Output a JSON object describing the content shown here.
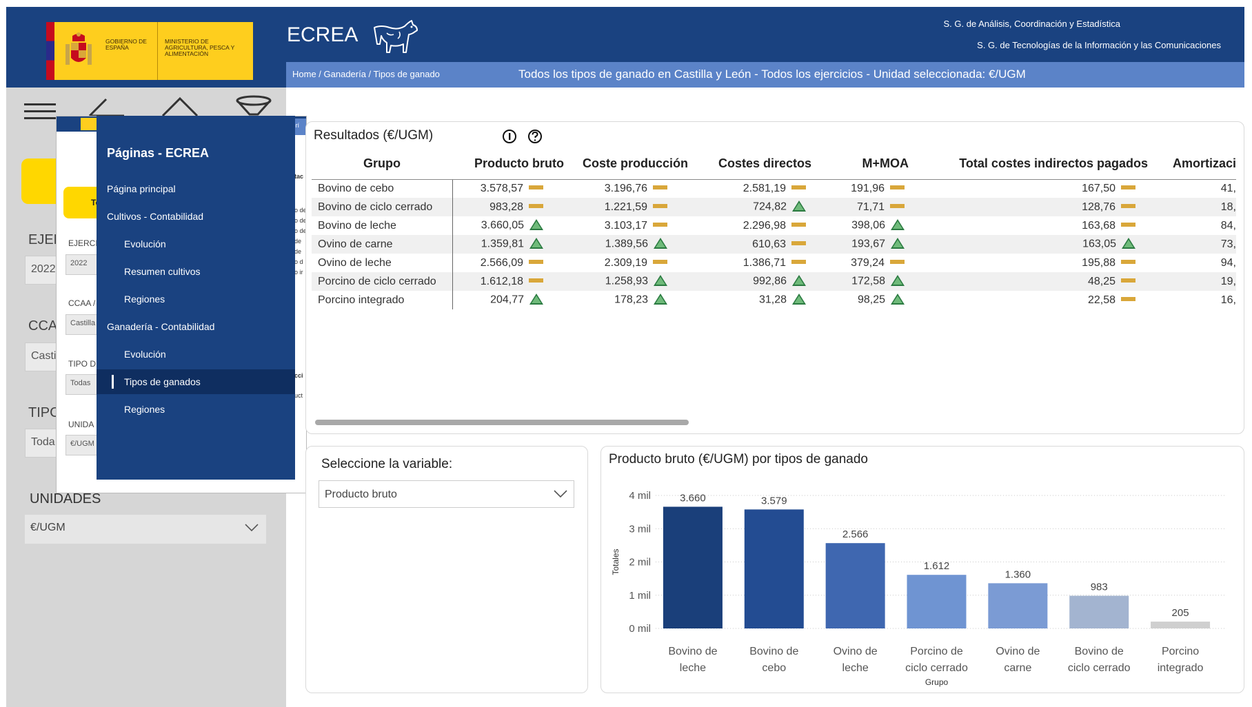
{
  "header": {
    "gov_text": "GOBIERNO DE ESPAÑA",
    "ministry_text": "MINISTERIO DE AGRICULTURA, PESCA Y ALIMENTACIÓN",
    "app_title": "ECREA",
    "sg_line1": "S. G. de Análisis, Coordinación y Estadística",
    "sg_line2": "S. G. de Tecnologías de la Información y las Comunicaciones",
    "colors": {
      "primary": "#1a4280",
      "subbar": "#5b83c8",
      "gov_yellow": "#fece1e"
    }
  },
  "subbar": {
    "breadcrumb": "Home / Ganadería / Tipos de ganado",
    "context": "Todos los tipos de ganado en Castilla y León - Todos los ejercicios - Unidad seleccionada: €/UGM"
  },
  "toolbar_icons": [
    "hamburger-icon",
    "back-icon",
    "home-icon",
    "clear-filter-icon"
  ],
  "left_panel": {
    "ejercicio_label": "EJER",
    "ejercicio_value": "2022",
    "ccaa_label": "CCA",
    "ccaa_value": "Casti",
    "tipo_label": "TIPC",
    "tipo_value": "Toda",
    "unidades_label": "UNIDADES",
    "unidades_value": "€/UGM"
  },
  "mini_preview": {
    "crumb": "Home / Ganaderí",
    "button": "To",
    "ejercicio_label": "EJERCI",
    "ejercicio_value": "2022",
    "ccaa_label": "CCAA /",
    "ccaa_value": "Castilla",
    "tipo_label": "TIPO D",
    "tipo_value": "Todas",
    "unidad_label": "UNIDA",
    "unidad_value": "€/UGM",
    "strip_top": "tac",
    "strip_lines": [
      "o de",
      "o de",
      "o de",
      "de",
      "de",
      "o d",
      "o ir"
    ],
    "strip_bottom1": "cci",
    "strip_bottom2": "uct"
  },
  "nav_menu": {
    "title": "Páginas - ECREA",
    "items": [
      {
        "label": "Página principal",
        "level": 0
      },
      {
        "label": "Cultivos - Contabilidad",
        "level": 0
      },
      {
        "label": "Evolución",
        "level": 1
      },
      {
        "label": "Resumen cultivos",
        "level": 1
      },
      {
        "label": "Regiones",
        "level": 1
      },
      {
        "label": "Ganadería - Contabilidad",
        "level": 0
      },
      {
        "label": "Evolución",
        "level": 1
      },
      {
        "label": "Tipos de ganados",
        "level": 1,
        "active": true
      },
      {
        "label": "Regiones",
        "level": 1
      }
    ]
  },
  "results": {
    "title": "Resultados (€/UGM)",
    "columns": [
      "Grupo",
      "Producto bruto",
      "Coste producción",
      "Costes directos",
      "M+MOA",
      "Total costes indirectos pagados",
      "Amortizaci"
    ],
    "rows": [
      {
        "grupo": "Bovino de cebo",
        "cells": [
          [
            "3.578,57",
            "bar"
          ],
          [
            "3.196,76",
            "bar"
          ],
          [
            "2.581,19",
            "bar"
          ],
          [
            "191,96",
            "bar"
          ],
          [
            "167,50",
            "bar"
          ],
          [
            "41,",
            ""
          ]
        ]
      },
      {
        "grupo": "Bovino de ciclo cerrado",
        "cells": [
          [
            "983,28",
            "bar"
          ],
          [
            "1.221,59",
            "bar"
          ],
          [
            "724,82",
            "up"
          ],
          [
            "71,71",
            "bar"
          ],
          [
            "128,76",
            "bar"
          ],
          [
            "18,",
            ""
          ]
        ]
      },
      {
        "grupo": "Bovino de leche",
        "cells": [
          [
            "3.660,05",
            "up"
          ],
          [
            "3.103,17",
            "bar"
          ],
          [
            "2.296,98",
            "bar"
          ],
          [
            "398,06",
            "up"
          ],
          [
            "163,68",
            "bar"
          ],
          [
            "84,",
            ""
          ]
        ]
      },
      {
        "grupo": "Ovino de carne",
        "cells": [
          [
            "1.359,81",
            "up"
          ],
          [
            "1.389,56",
            "up"
          ],
          [
            "610,63",
            "bar"
          ],
          [
            "193,67",
            "up"
          ],
          [
            "163,05",
            "up"
          ],
          [
            "73,",
            ""
          ]
        ]
      },
      {
        "grupo": "Ovino de leche",
        "cells": [
          [
            "2.566,09",
            "bar"
          ],
          [
            "2.309,19",
            "bar"
          ],
          [
            "1.386,71",
            "bar"
          ],
          [
            "379,24",
            "bar"
          ],
          [
            "195,88",
            "bar"
          ],
          [
            "94,",
            ""
          ]
        ]
      },
      {
        "grupo": "Porcino de ciclo cerrado",
        "cells": [
          [
            "1.612,18",
            "bar"
          ],
          [
            "1.258,93",
            "up"
          ],
          [
            "992,86",
            "up"
          ],
          [
            "172,58",
            "up"
          ],
          [
            "48,25",
            "bar"
          ],
          [
            "19,",
            ""
          ]
        ]
      },
      {
        "grupo": "Porcino integrado",
        "cells": [
          [
            "204,77",
            "up"
          ],
          [
            "178,23",
            "up"
          ],
          [
            "31,28",
            "up"
          ],
          [
            "98,25",
            "up"
          ],
          [
            "22,58",
            "bar"
          ],
          [
            "16,",
            ""
          ]
        ]
      }
    ],
    "indicator_colors": {
      "bar": "#d9a73a",
      "up": "#2a7a40"
    }
  },
  "selector": {
    "title": "Seleccione la variable:",
    "value": "Producto bruto"
  },
  "chart_data": {
    "type": "bar",
    "title": "Producto bruto (€/UGM) por tipos de ganado",
    "xlabel": "Grupo",
    "ylabel": "Totales",
    "ylim": [
      0,
      4000
    ],
    "yticks": [
      0,
      1000,
      2000,
      3000,
      4000
    ],
    "ytick_labels": [
      "0 mil",
      "1 mil",
      "2 mil",
      "3 mil",
      "4 mil"
    ],
    "grid": true,
    "categories": [
      [
        "Bovino de",
        "leche"
      ],
      [
        "Bovino de",
        "cebo"
      ],
      [
        "Ovino de",
        "leche"
      ],
      [
        "Porcino de",
        "ciclo cerrado"
      ],
      [
        "Ovino de",
        "carne"
      ],
      [
        "Bovino de",
        "ciclo cerrado"
      ],
      [
        "Porcino",
        "integrado"
      ]
    ],
    "values": [
      3660.05,
      3578.57,
      2566.09,
      1612.18,
      1359.81,
      983.28,
      204.77
    ],
    "value_labels": [
      "3.660",
      "3.579",
      "2.566",
      "1.612",
      "1.360",
      "983",
      "205"
    ],
    "colors": [
      "#1a3f7a",
      "#234c92",
      "#3f67b0",
      "#6f94d2",
      "#7b9bd4",
      "#a3b4d0",
      "#cfcfcf"
    ]
  }
}
